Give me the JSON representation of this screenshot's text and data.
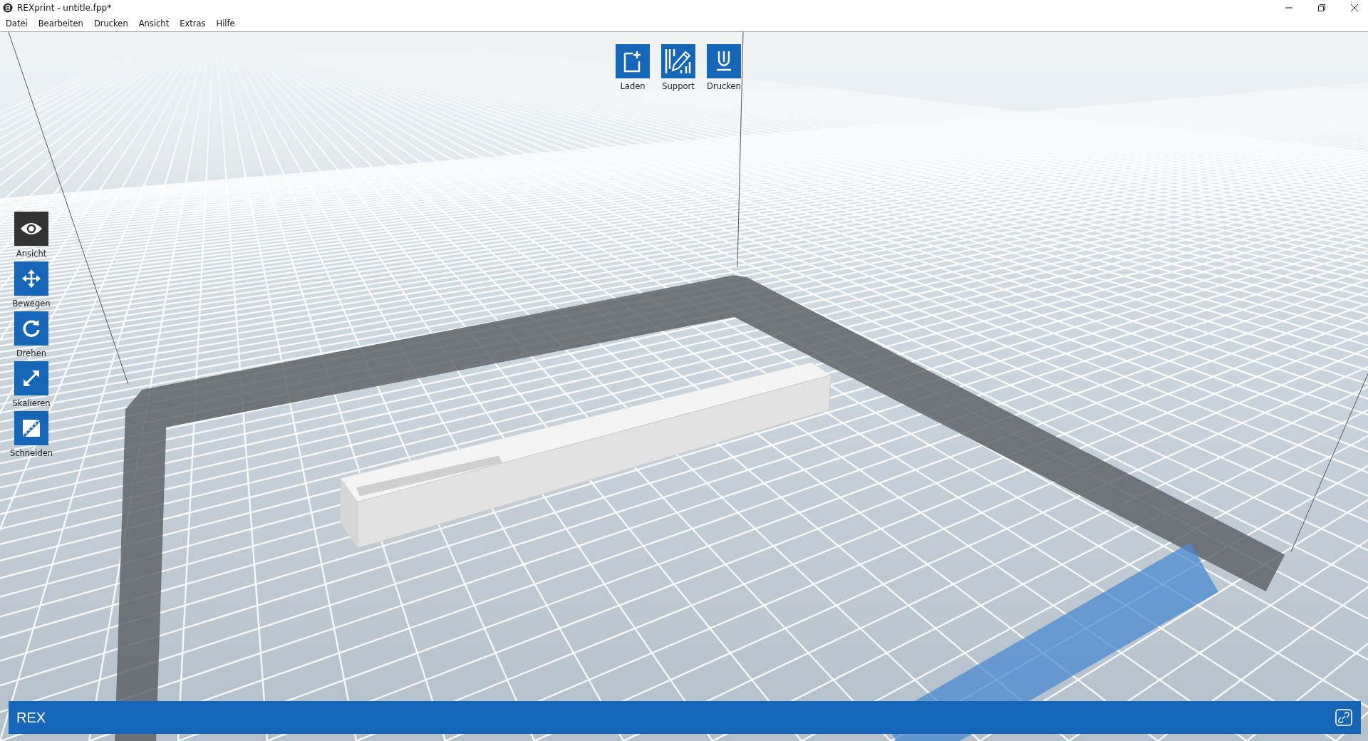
{
  "window": {
    "title": "REXprint - untitle.fpp*"
  },
  "menu": [
    "Datei",
    "Bearbeiten",
    "Drucken",
    "Ansicht",
    "Extras",
    "Hilfe"
  ],
  "toolbar": [
    {
      "label": "Laden",
      "kind": "load"
    },
    {
      "label": "Support",
      "kind": "support"
    },
    {
      "label": "Drucken",
      "kind": "print"
    }
  ],
  "tools": [
    {
      "label": "Ansicht",
      "kind": "view",
      "selected": true
    },
    {
      "label": "Bewegen",
      "kind": "move",
      "selected": false
    },
    {
      "label": "Drehen",
      "kind": "rotate",
      "selected": false
    },
    {
      "label": "Skalieren",
      "kind": "scale",
      "selected": false
    },
    {
      "label": "Schneiden",
      "kind": "cut",
      "selected": false
    }
  ],
  "status_bar": {
    "label": "REX"
  }
}
